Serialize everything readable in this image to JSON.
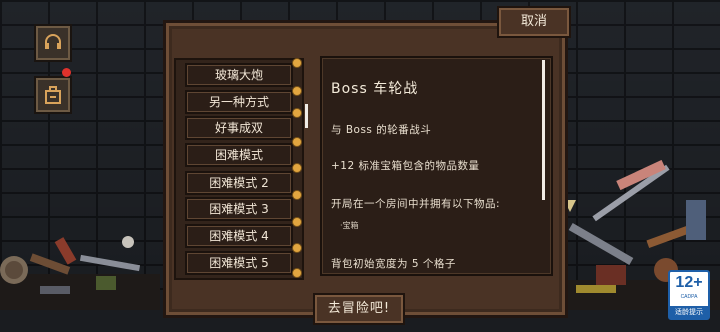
{
  "dialog": {
    "cancel_label": "取消",
    "start_label": "去冒险吧!",
    "list": [
      {
        "label": "玻璃大炮",
        "selected": false
      },
      {
        "label": "另一种方式",
        "selected": false
      },
      {
        "label": "好事成双",
        "selected": false
      },
      {
        "label": "困难模式",
        "selected": false
      },
      {
        "label": "困难模式 2",
        "selected": false
      },
      {
        "label": "困难模式 3",
        "selected": false
      },
      {
        "label": "困难模式 4",
        "selected": false
      },
      {
        "label": "困难模式 5",
        "selected": false
      }
    ],
    "detail": {
      "title": "Boss 车轮战",
      "lines": [
        "与 Boss 的轮番战斗",
        "+12 标准宝箱包含的物品数量",
        "开局在一个房间中并拥有以下物品:",
        "·宝箱",
        "背包初始宽度为 5 个格子"
      ]
    }
  },
  "hud": {
    "icons": [
      "headset-icon",
      "inventory-bag-icon"
    ],
    "notification": true
  },
  "age_rating": {
    "age": "12+",
    "org": "CADPA",
    "note": "适龄提示"
  },
  "colors": {
    "panel": "#4a3325",
    "panel_border": "#6e4e37",
    "text": "#f1e6d6",
    "pin": "#e2a640",
    "notification": "#e0322c",
    "rating_blue": "#1e5fa8"
  }
}
